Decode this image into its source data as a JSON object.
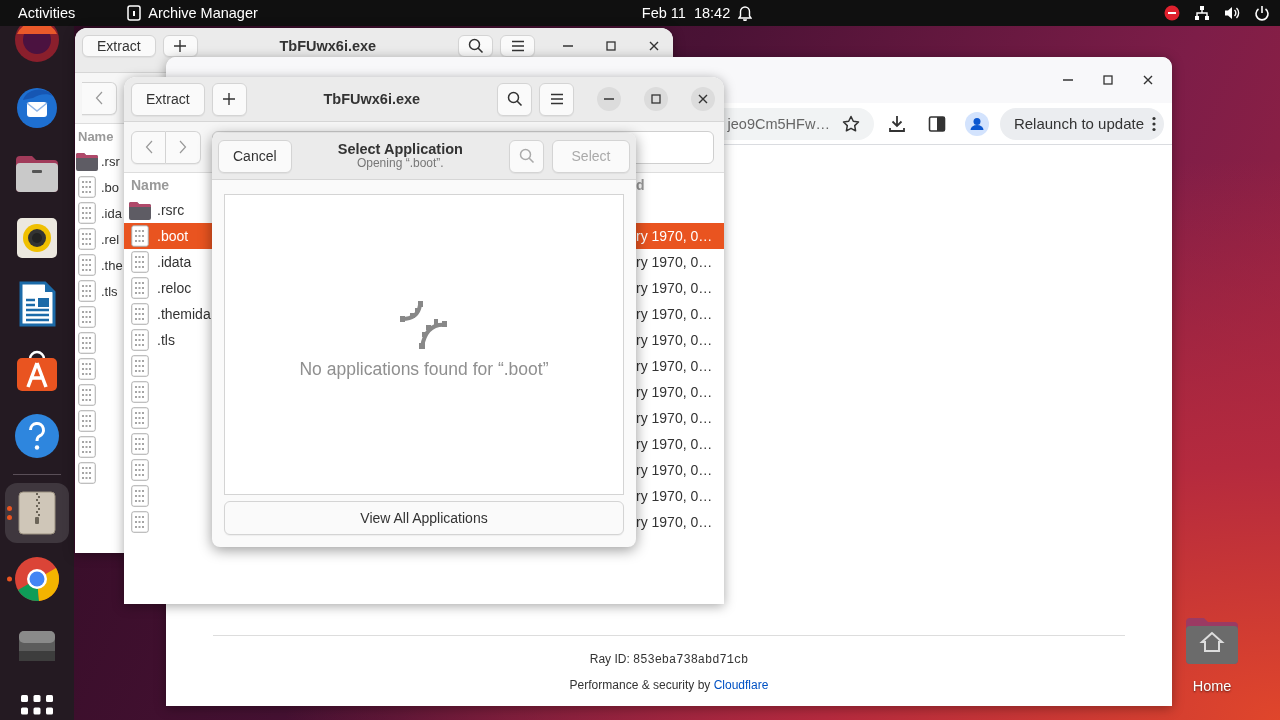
{
  "top_bar": {
    "activities": "Activities",
    "app_menu": "Archive Manager",
    "date": "Feb 11",
    "time": "18:42"
  },
  "dock": {
    "items": [
      {
        "kind": "orb",
        "running": false,
        "multiple_windows": false,
        "selected": false
      },
      {
        "kind": "mail",
        "running": false,
        "multiple_windows": false,
        "selected": false
      },
      {
        "kind": "files",
        "running": false,
        "multiple_windows": false,
        "selected": false
      },
      {
        "kind": "music",
        "running": false,
        "multiple_windows": false,
        "selected": false
      },
      {
        "kind": "writer",
        "running": false,
        "multiple_windows": false,
        "selected": false
      },
      {
        "kind": "store",
        "running": false,
        "multiple_windows": false,
        "selected": false
      },
      {
        "kind": "help",
        "running": false,
        "multiple_windows": false,
        "selected": false
      },
      {
        "kind": "separator"
      },
      {
        "kind": "archive",
        "running": true,
        "multiple_windows": true,
        "selected": true
      },
      {
        "kind": "browser",
        "running": true,
        "multiple_windows": false,
        "selected": false
      },
      {
        "kind": "drive",
        "running": false,
        "multiple_windows": false,
        "selected": false
      },
      {
        "kind": "apps",
        "running": false,
        "multiple_windows": false,
        "selected": false
      }
    ]
  },
  "archive_back": {
    "extract": "Extract",
    "title": "TbFUwx6i.exe",
    "columns": [
      "Name"
    ],
    "rows": [
      {
        "kind": "folder",
        "name": ".rsr",
        "selected": false
      },
      {
        "kind": "file",
        "name": ".bo",
        "selected": false
      },
      {
        "kind": "file",
        "name": ".ida",
        "selected": false
      },
      {
        "kind": "file",
        "name": ".rel",
        "selected": false
      },
      {
        "kind": "file",
        "name": ".the",
        "selected": false
      },
      {
        "kind": "file",
        "name": ".tls",
        "selected": false
      },
      {
        "kind": "file",
        "selected": false
      },
      {
        "kind": "file",
        "selected": false
      },
      {
        "kind": "file",
        "selected": false
      },
      {
        "kind": "file",
        "selected": false
      },
      {
        "kind": "file",
        "selected": false
      },
      {
        "kind": "file",
        "selected": false
      },
      {
        "kind": "file",
        "selected": false
      }
    ]
  },
  "browser": {
    "url": "jeo9Cm5HFw…",
    "relaunch": "Relaunch to update",
    "ray_id_label": "Ray ID:",
    "ray_id": "853eba738abd71cb",
    "footer_text": "Performance & security by",
    "footer_link": "Cloudflare"
  },
  "archive_front": {
    "extract": "Extract",
    "title": "TbFUwx6i.exe",
    "columns": [
      "Name",
      "d"
    ],
    "rows": [
      {
        "kind": "folder",
        "name": ".rsrc",
        "selected": false
      },
      {
        "kind": "file",
        "name": ".boot",
        "modified": "ry 1970, 0…",
        "selected": true
      },
      {
        "kind": "file",
        "name": ".idata",
        "modified": "ry 1970, 0…",
        "selected": false
      },
      {
        "kind": "file",
        "name": ".reloc",
        "modified": "ry 1970, 0…",
        "selected": false
      },
      {
        "kind": "file",
        "name": ".themida",
        "modified": "ry 1970, 0…",
        "selected": false
      },
      {
        "kind": "file",
        "name": ".tls",
        "modified": "ry 1970, 0…",
        "selected": false
      },
      {
        "kind": "file",
        "modified": "ry 1970, 0…",
        "selected": false
      },
      {
        "kind": "file",
        "modified": "ry 1970, 0…",
        "selected": false
      },
      {
        "kind": "file",
        "modified": "ry 1970, 0…",
        "selected": false
      },
      {
        "kind": "file",
        "modified": "ry 1970, 0…",
        "selected": false
      },
      {
        "kind": "file",
        "modified": "ry 1970, 0…",
        "selected": false
      },
      {
        "kind": "file",
        "modified": "ry 1970, 0…",
        "selected": false
      },
      {
        "kind": "file",
        "modified": "ry 1970, 0…",
        "selected": false
      }
    ]
  },
  "dialog": {
    "cancel": "Cancel",
    "title": "Select Application",
    "subtitle": "Opening “.boot”.",
    "select": "Select",
    "select_disabled": true,
    "empty_message": "No applications found for “.boot”",
    "view_all": "View All Applications"
  },
  "desktop_icons": [
    {
      "label": "Home"
    }
  ]
}
